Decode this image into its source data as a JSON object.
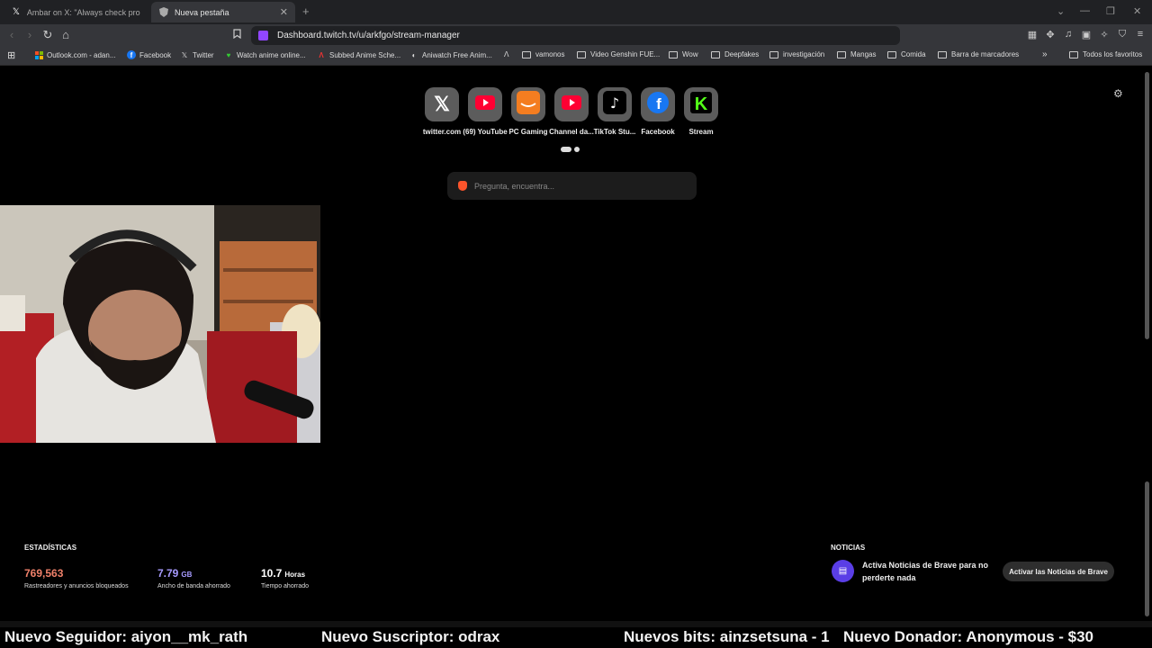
{
  "tabs": [
    {
      "title": "Ambar on X: \"Always check properly",
      "icon": "x-logo-icon"
    },
    {
      "title": "Nueva pestaña",
      "icon": "brave-shield-icon"
    }
  ],
  "address": "Dashboard.twitch.tv/u/arkfgo/stream-manager",
  "bookmarks": [
    {
      "label": "Outlook.com - adan...",
      "icon": "microsoft-icon"
    },
    {
      "label": "Facebook",
      "icon": "facebook-icon"
    },
    {
      "label": "Twitter",
      "icon": "x-logo-icon"
    },
    {
      "label": "Watch anime online...",
      "icon": "heart-icon"
    },
    {
      "label": "Subbed Anime Sche...",
      "icon": "anime-icon"
    },
    {
      "label": "Aniwatch Free Anim...",
      "icon": "aniwatch-icon"
    },
    {
      "label": "vamonos",
      "icon": "folder-icon"
    },
    {
      "label": "Video Genshin FUE...",
      "icon": "folder-icon"
    },
    {
      "label": "Wow",
      "icon": "folder-icon"
    },
    {
      "label": "Deepfakes",
      "icon": "folder-icon"
    },
    {
      "label": "investigación",
      "icon": "folder-icon"
    },
    {
      "label": "Mangas",
      "icon": "folder-icon"
    },
    {
      "label": "Comida",
      "icon": "folder-icon"
    },
    {
      "label": "Barra de marcadores",
      "icon": "folder-icon"
    }
  ],
  "all_bookmarks": "Todos los favoritos",
  "top_sites": [
    {
      "label": "twitter.com",
      "icon": "x-logo-icon"
    },
    {
      "label": "(69) YouTube",
      "icon": "youtube-icon"
    },
    {
      "label": "PC Gaming",
      "icon": "amazon-icon"
    },
    {
      "label": "Channel da...",
      "icon": "youtube-icon"
    },
    {
      "label": "TikTok Stu...",
      "icon": "tiktok-icon"
    },
    {
      "label": "Facebook",
      "icon": "facebook-icon"
    },
    {
      "label": "Stream",
      "icon": "kick-icon"
    }
  ],
  "search_placeholder": "Pregunta, encuentra...",
  "stats": {
    "title": "ESTADÍSTICAS",
    "trackers_value": "769,563",
    "trackers_label": "Rastreadores y anuncios bloqueados",
    "bandwidth_value": "7.79",
    "bandwidth_unit": "GB",
    "bandwidth_label": "Ancho de banda ahorrado",
    "time_value": "10.7",
    "time_unit": "Horas",
    "time_label": "Tiempo ahorrado"
  },
  "news": {
    "title": "NOTICIAS",
    "text": "Activa Noticias de Brave para no perderte nada",
    "button": "Activar las Noticias de Brave"
  },
  "ticker": [
    "Nuevo Seguidor: aiyon__mk_rath",
    "Nuevo Suscriptor: odrax",
    "Nuevos bits: ainzsetsuna - 1",
    "Nuevo Donador: Anonymous - $30"
  ],
  "colors": {
    "trackers": "#f0816a",
    "bandwidth": "#a79bff",
    "time": "#ffffff",
    "news_icon": "#5a3ee6",
    "twitch": "#9146ff"
  }
}
